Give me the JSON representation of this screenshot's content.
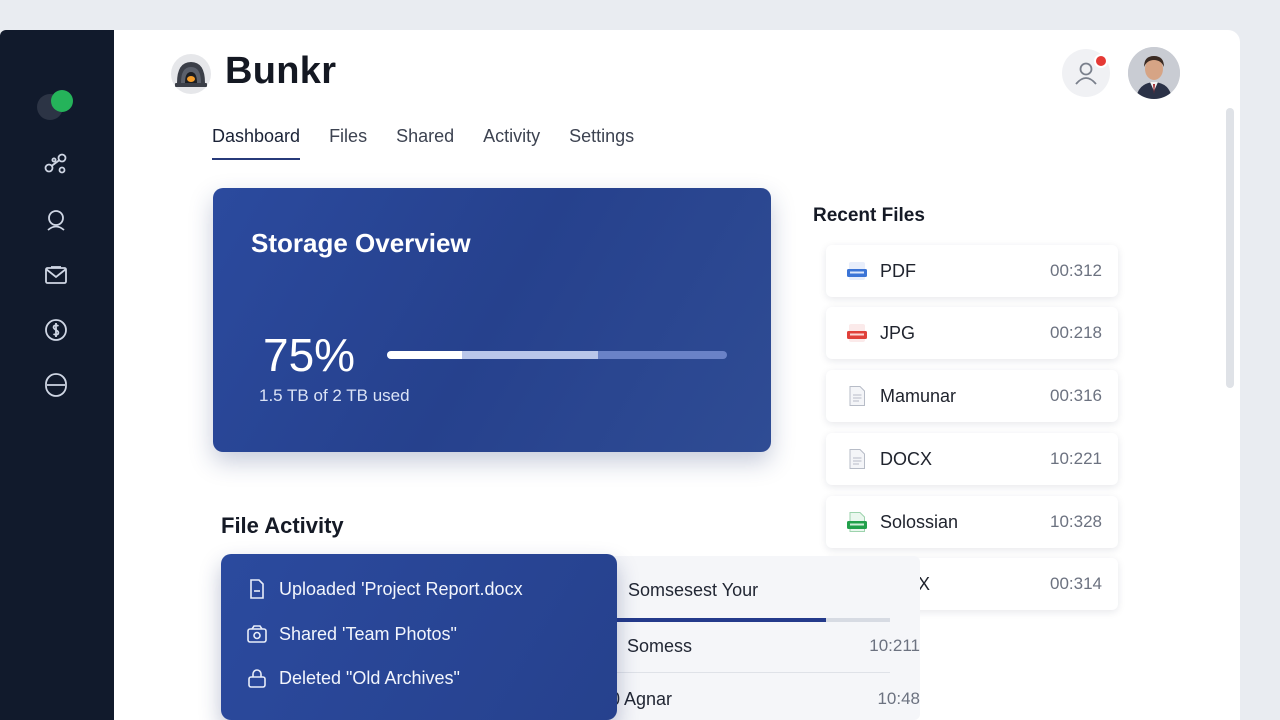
{
  "app": {
    "name": "Bunkr"
  },
  "sidebar": {
    "icons": [
      "share-icon",
      "user-icon",
      "mail-icon",
      "billing-icon",
      "globe-icon"
    ]
  },
  "header": {
    "notification_count": "1",
    "colors": {
      "notification": "#e53935"
    }
  },
  "tabs": [
    {
      "label": "Dashboard",
      "active": true
    },
    {
      "label": "Files",
      "active": false
    },
    {
      "label": "Shared",
      "active": false
    },
    {
      "label": "Activity",
      "active": false
    },
    {
      "label": "Settings",
      "active": false
    }
  ],
  "storage": {
    "title": "Storage Overview",
    "percent_label": "75%",
    "used_label": "1.5 TB of 2 TB used",
    "primary_fill": 0.22,
    "secondary_fill": 0.62,
    "colors": {
      "card": "#2a4596",
      "bar_primary": "#ffffff",
      "bar_secondary": "#b9c6ea"
    }
  },
  "recent_files": {
    "title": "Recent Files",
    "items": [
      {
        "name": "PDF",
        "time": "00:312",
        "icon": "doc-badge-blue-icon"
      },
      {
        "name": "JPG",
        "time": "00:218",
        "icon": "pdf-badge-red-icon"
      },
      {
        "name": "Mamunar",
        "time": "00:316",
        "icon": "document-icon"
      },
      {
        "name": "DOCX",
        "time": "10:221",
        "icon": "document-icon"
      },
      {
        "name": "Solossian",
        "time": "10:328",
        "icon": "image-badge-green-icon"
      },
      {
        "name": "DOCX",
        "time": "00:314",
        "icon": "image-badge-green-icon"
      }
    ]
  },
  "file_activity": {
    "title": "File Activity",
    "events": [
      {
        "text": "Uploaded 'Project Report.docx",
        "icon": "file-upload-icon"
      },
      {
        "text": "Shared 'Team Photos\"",
        "icon": "image-share-icon"
      },
      {
        "text": "Deleted \"Old Archives\"",
        "icon": "lock-delete-icon"
      }
    ],
    "table": {
      "rows": [
        {
          "name": "Somsesest Your",
          "time": ""
        },
        {
          "name": "Somess",
          "time": "10:211"
        },
        {
          "name": "0 Agnar",
          "time": "10:48"
        }
      ],
      "progress": 0.77
    }
  }
}
